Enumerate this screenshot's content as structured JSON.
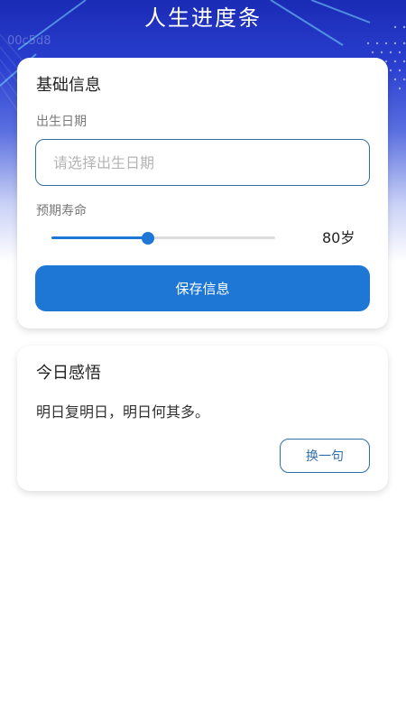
{
  "header": {
    "title": "人生进度条",
    "watermark": "00c5d8"
  },
  "basic_info": {
    "title": "基础信息",
    "birth_date_label": "出生日期",
    "birth_date_placeholder": "请选择出生日期",
    "birth_date_value": "",
    "life_expectancy_label": "预期寿命",
    "life_expectancy_value": "80岁",
    "life_expectancy_slider_fraction": 0.43,
    "save_button_label": "保存信息"
  },
  "daily_insight": {
    "title": "今日感悟",
    "quote": "明日复明日，明日何其多。",
    "change_button_label": "换一句"
  },
  "colors": {
    "banner_top": "#1a2bb5",
    "accent": "#1e77d4",
    "outline": "#2f6fa8"
  }
}
